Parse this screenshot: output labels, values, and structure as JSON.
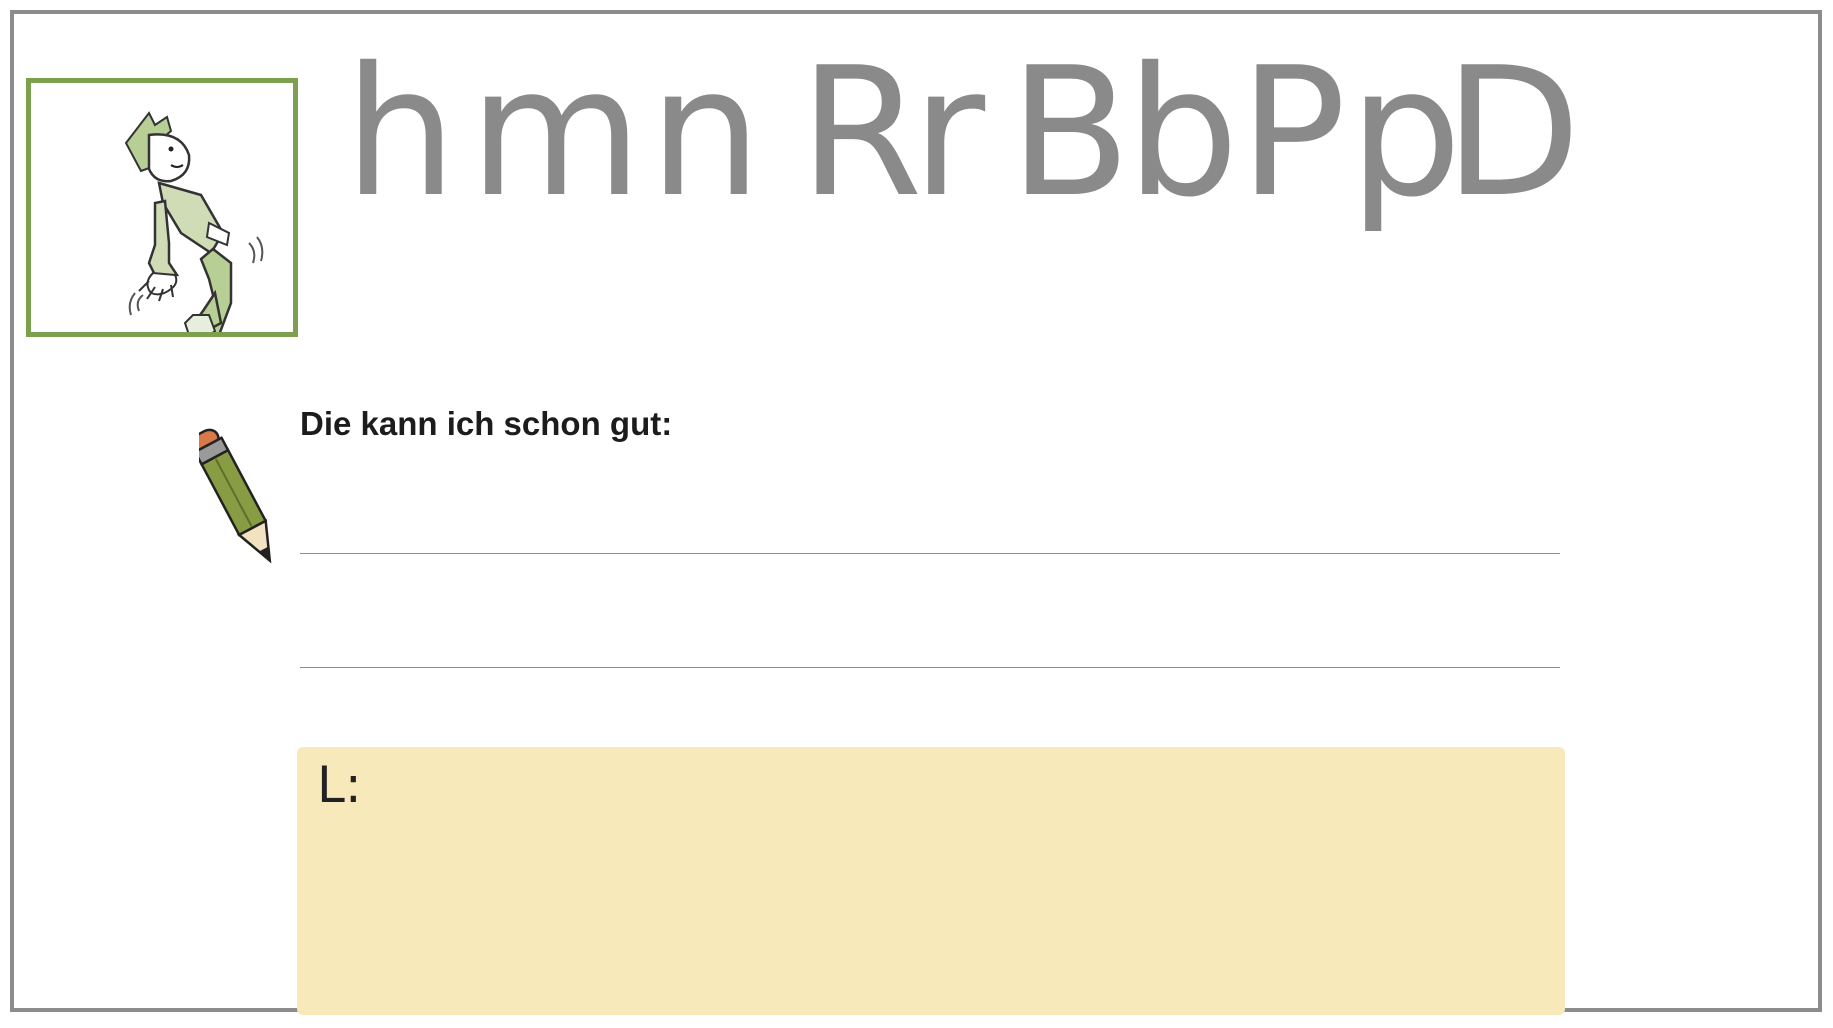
{
  "worksheet": {
    "letters": [
      "h",
      "m",
      "n",
      "R",
      "r",
      "B",
      "b",
      "P",
      "p",
      "D"
    ],
    "prompt": "Die kann ich schon gut:",
    "teacher_label": "L:"
  },
  "icons": {
    "character": "jumping-boy-illustration",
    "pencil": "pencil-icon"
  },
  "colors": {
    "frame": "#8c8c8c",
    "accent_green": "#7ca04e",
    "letters": "#8a8a8a",
    "teacher_box": "#f8e9bb"
  }
}
